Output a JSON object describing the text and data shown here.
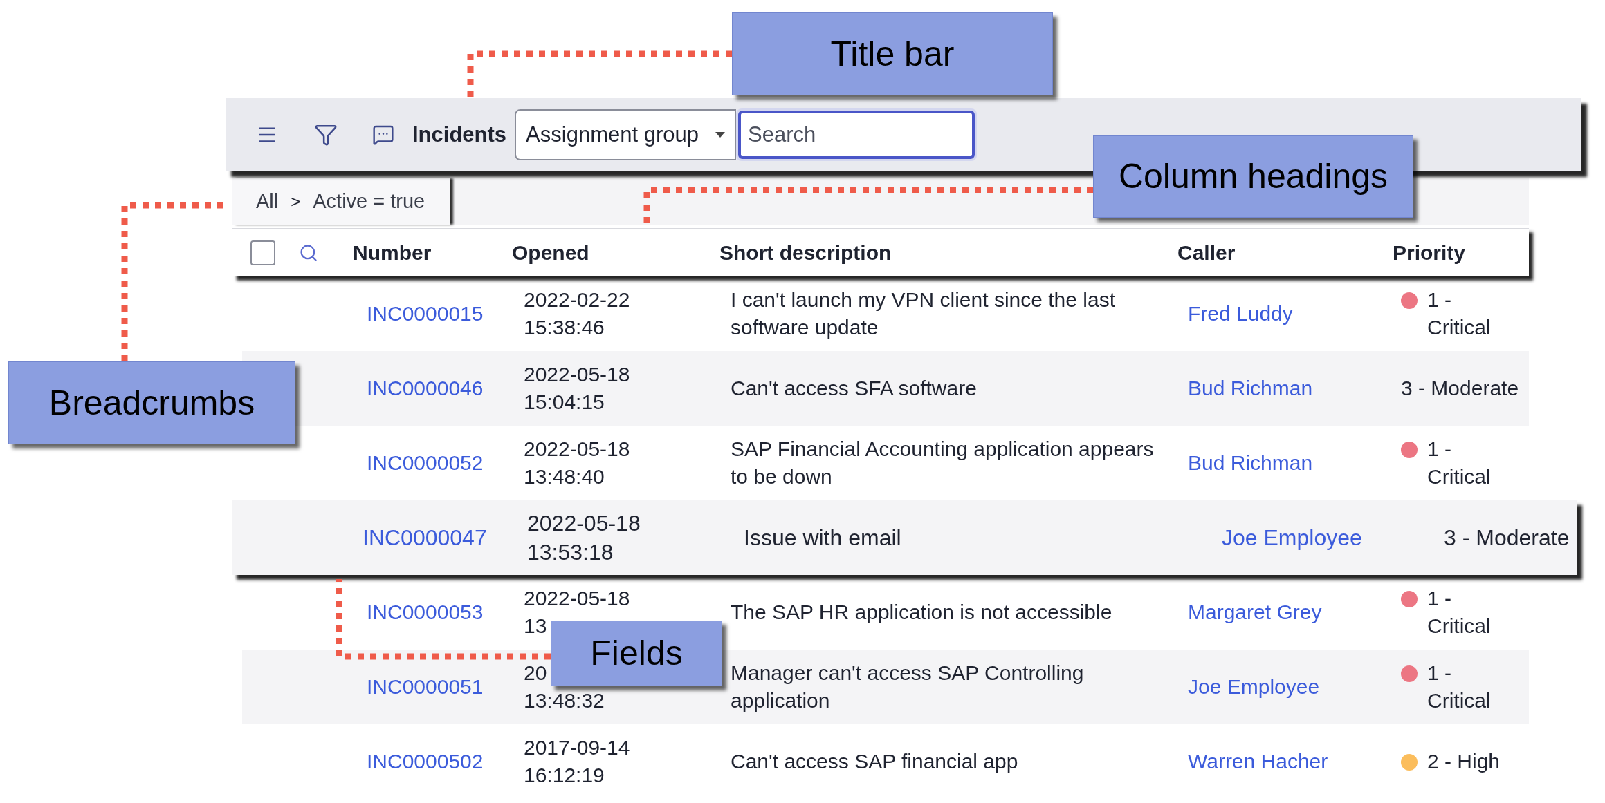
{
  "title_bar": {
    "title": "Incidents",
    "field_select": {
      "value": "Assignment group"
    },
    "search": {
      "placeholder": "Search"
    }
  },
  "breadcrumbs": {
    "items": [
      "All",
      "Active = true"
    ],
    "separator": ">"
  },
  "table": {
    "columns": [
      "Number",
      "Opened",
      "Short description",
      "Caller",
      "Priority"
    ],
    "select_all": {
      "checked": false
    },
    "rows": [
      {
        "number": "INC0000015",
        "opened": [
          "2022-02-22",
          "15:38:46"
        ],
        "description": "I can't launch my VPN client since the last software update",
        "caller": "Fred Luddy",
        "priority": "1 - Critical",
        "color": "#ec7683",
        "emphasized": false
      },
      {
        "number": "INC0000046",
        "opened": [
          "2022-05-18",
          "15:04:15"
        ],
        "description": "Can't access SFA software",
        "caller": "Bud Richman",
        "priority": "3 - Moderate",
        "emphasized": false
      },
      {
        "number": "INC0000052",
        "opened": [
          "2022-05-18",
          "13:48:40"
        ],
        "description": "SAP Financial Accounting application appears to be down",
        "caller": "Bud Richman",
        "priority": "1 - Critical",
        "color": "#ec7683",
        "emphasized": false
      },
      {
        "number": "INC0000047",
        "opened": [
          "2022-05-18",
          "13:53:18"
        ],
        "description": "Issue with email",
        "caller": "Joe Employee",
        "priority": "3 - Moderate",
        "emphasized": true
      },
      {
        "number": "INC0000053",
        "opened": [
          "2022-05-18",
          "13"
        ],
        "description": "The SAP HR application is not accessible",
        "caller": "Margaret Grey",
        "priority": "1 - Critical",
        "color": "#ec7683",
        "emphasized": false
      },
      {
        "number": "INC0000051",
        "opened": [
          "20",
          "13:48:32"
        ],
        "description": "Manager can't access SAP Controlling application",
        "caller": "Joe Employee",
        "priority": "1 - Critical",
        "color": "#ec7683",
        "emphasized": false
      },
      {
        "number": "INC0000502",
        "opened": [
          "2017-09-14",
          "16:12:19"
        ],
        "description": "Can't access SAP financial app",
        "caller": "Warren Hacher",
        "priority": "2 - High",
        "color": "#fbbd5c",
        "emphasized": false
      }
    ]
  },
  "callouts": [
    {
      "kind": "title_bar",
      "text": "Title bar"
    },
    {
      "kind": "column_headings",
      "text": "Column headings"
    },
    {
      "kind": "breadcrumbs",
      "text": "Breadcrumbs"
    },
    {
      "kind": "fields",
      "text": "Fields"
    }
  ]
}
